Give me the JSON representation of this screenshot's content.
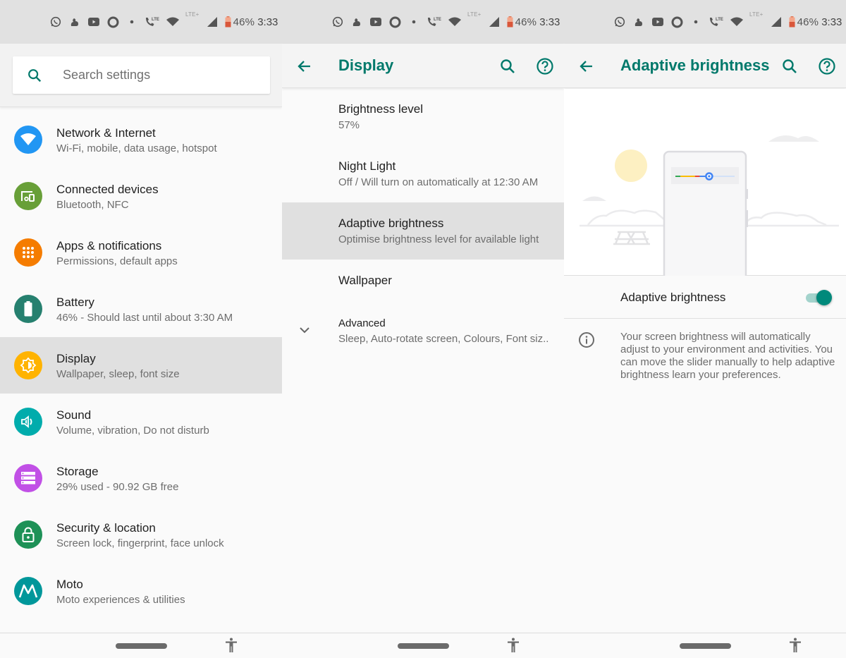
{
  "status_bar": {
    "icons": [
      "whatsapp-icon",
      "uc-browser-icon",
      "youtube-icon",
      "circle-app-icon",
      "dot-icon",
      "volte-call-icon",
      "wifi-icon",
      "lte-plus-icon",
      "signal-icon",
      "battery-icon"
    ],
    "volte_label": "LTE",
    "lte_label": "LTE+",
    "battery_percent": "46%",
    "time": "3:33"
  },
  "panel_settings": {
    "search": {
      "placeholder": "Search settings",
      "value": ""
    },
    "items": [
      {
        "icon": "wifi-icon",
        "color": "#2196f3",
        "title": "Network & Internet",
        "subtitle": "Wi-Fi, mobile, data usage, hotspot",
        "selected": false
      },
      {
        "icon": "devices-icon",
        "color": "#689f38",
        "title": "Connected devices",
        "subtitle": "Bluetooth, NFC",
        "selected": false
      },
      {
        "icon": "apps-grid-icon",
        "color": "#f57c00",
        "title": "Apps & notifications",
        "subtitle": "Permissions, default apps",
        "selected": false
      },
      {
        "icon": "battery-icon",
        "color": "#26806f",
        "title": "Battery",
        "subtitle": "46% - Should last until about 3:30 AM",
        "selected": false
      },
      {
        "icon": "brightness-icon",
        "color": "#ffb300",
        "title": "Display",
        "subtitle": "Wallpaper, sleep, font size",
        "selected": true
      },
      {
        "icon": "volume-icon",
        "color": "#00acac",
        "title": "Sound",
        "subtitle": "Volume, vibration, Do not disturb",
        "selected": false
      },
      {
        "icon": "storage-icon",
        "color": "#c150e6",
        "title": "Storage",
        "subtitle": "29% used - 90.92 GB free",
        "selected": false
      },
      {
        "icon": "lock-icon",
        "color": "#1e9157",
        "title": "Security & location",
        "subtitle": "Screen lock, fingerprint, face unlock",
        "selected": false
      },
      {
        "icon": "motorola-icon",
        "color": "#00979a",
        "title": "Moto",
        "subtitle": "Moto experiences & utilities",
        "selected": false
      }
    ]
  },
  "panel_display": {
    "title": "Display",
    "items": [
      {
        "title": "Brightness level",
        "subtitle": "57%",
        "selected": false
      },
      {
        "title": "Night Light",
        "subtitle": "Off / Will turn on automatically at 12:30 AM",
        "selected": false
      },
      {
        "title": "Adaptive brightness",
        "subtitle": "Optimise brightness level for available light",
        "selected": true
      },
      {
        "title": "Wallpaper",
        "subtitle": "",
        "selected": false
      },
      {
        "title": "Advanced",
        "subtitle": "Sleep, Auto-rotate screen, Colours, Font siz..",
        "selected": false
      }
    ]
  },
  "panel_adaptive": {
    "title": "Adaptive brightness",
    "toggle_label": "Adaptive brightness",
    "toggle_on": true,
    "illustration_slider_level": 0.57,
    "info_text": "Your screen brightness will automatically adjust to your environment and activities. You can move the slider manually to help adaptive brightness learn your preferences."
  },
  "colors": {
    "accent": "#00796b",
    "toggle_thumb": "#00897b",
    "toggle_track": "#a3d3cc",
    "selected_row": "#e0e0e0"
  }
}
